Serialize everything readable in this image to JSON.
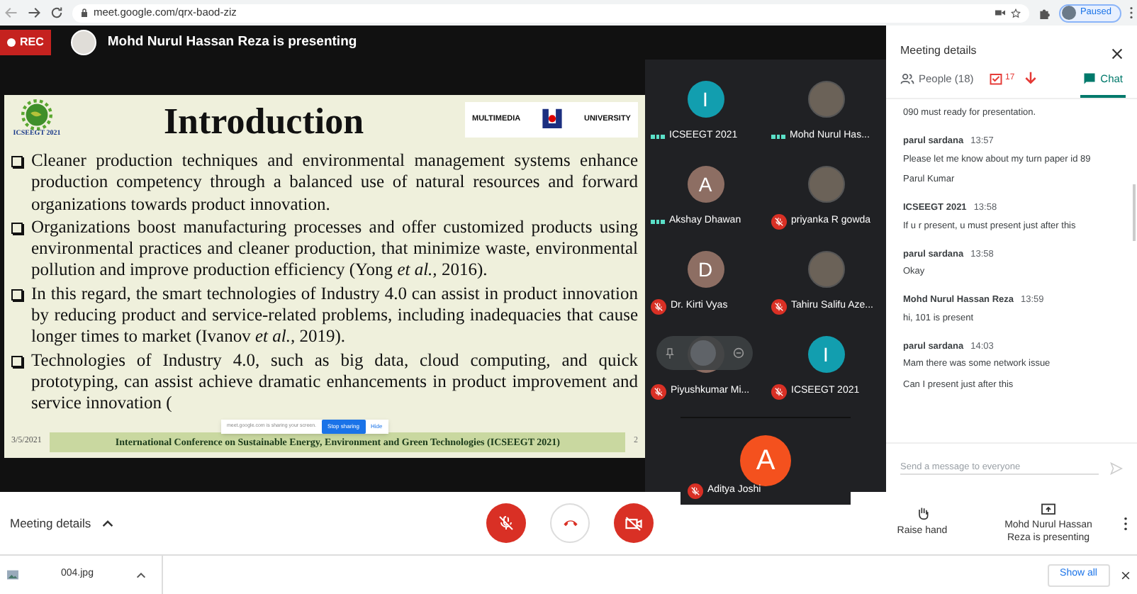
{
  "browser": {
    "url": "meet.google.com/qrx-baod-ziz",
    "profile": "Paused"
  },
  "recording": {
    "label": "REC"
  },
  "presenter_banner": "Mohd Nurul Hassan Reza is presenting",
  "slide": {
    "title": "Introduction",
    "logo_caption": "ICSEEGT 2021",
    "partner_left": "MULTIMEDIA",
    "partner_right": "UNIVERSITY",
    "bullets": [
      "Cleaner production techniques and environmental management systems enhance production competency through a balanced use of natural resources and forward organizations towards product innovation.",
      "Organizations boost manufacturing processes and offer customized products using environmental practices and cleaner production, that minimize waste, environmental pollution and improve production efficiency (Yong *et al.,* 2016).",
      "In this regard, the smart technologies of Industry 4.0 can assist in product innovation by reducing product and service-related problems, including inadequacies that cause longer times to market (Ivanov *et al.,* 2019).",
      "Technologies of Industry 4.0, such as big data, cloud computing, and quick prototyping, can assist achieve dramatic enhancements in product improvement and service innovation ("
    ],
    "date": "3/5/2021",
    "footer": "International Conference on Sustainable Energy, Environment and Green Technologies (ICSEEGT 2021)",
    "page": "2"
  },
  "share_notice": {
    "text": "meet.google.com is sharing your screen.",
    "stop": "Stop sharing",
    "hide": "Hide"
  },
  "participants": [
    {
      "name": "ICSEEGT 2021",
      "kind": "letter",
      "letter": "I",
      "color": "#129eaf",
      "muted": false,
      "hover": false
    },
    {
      "name": "Mohd Nurul Has...",
      "kind": "photo",
      "muted": false,
      "hover": false
    },
    {
      "name": "Akshay Dhawan",
      "kind": "letter",
      "letter": "A",
      "color": "#8d6e63",
      "muted": false,
      "hover": false
    },
    {
      "name": "priyanka R gowda",
      "kind": "photo",
      "muted": true,
      "hover": false
    },
    {
      "name": "Dr. Kirti Vyas",
      "kind": "letter",
      "letter": "D",
      "color": "#8d6e63",
      "muted": true,
      "hover": false
    },
    {
      "name": "Tahiru Salifu Aze...",
      "kind": "photo",
      "muted": true,
      "hover": false
    },
    {
      "name": "Piyushkumar Mi...",
      "kind": "letter",
      "color": "#8d6e63",
      "muted": true,
      "hover": true
    },
    {
      "name": "ICSEEGT 2021",
      "kind": "letter",
      "letter": "I",
      "color": "#129eaf",
      "muted": true,
      "hover": false
    }
  ],
  "featured": {
    "name": "Aditya Joshi",
    "letter": "A",
    "color": "#f4511e",
    "muted": true
  },
  "panel": {
    "title": "Meeting details",
    "tabs": [
      {
        "label": "People (18)",
        "kind": "people",
        "selected": false
      },
      {
        "label": "Chat",
        "kind": "chat",
        "selected": true
      }
    ],
    "annotation": "17",
    "messages": [
      {
        "lines": [
          "090 must ready for presentation."
        ]
      },
      {
        "sender": "parul sardana",
        "time": "13:57",
        "lines": [
          "Please let me know about my turn paper id  89",
          "Parul Kumar"
        ]
      },
      {
        "sender": "ICSEEGT 2021",
        "time": "13:58",
        "lines": [
          "If u r present, u must present just after this"
        ]
      },
      {
        "sender": "parul sardana",
        "time": "13:58",
        "lines": [
          "Okay"
        ]
      },
      {
        "sender": "Mohd Nurul Hassan Reza",
        "time": "13:59",
        "lines": [
          "hi, 101 is present"
        ]
      },
      {
        "sender": "parul sardana",
        "time": "14:03",
        "lines": [
          "Mam there was some network issue",
          "Can I present just after this"
        ]
      }
    ],
    "input": {
      "placeholder": "Send a message to everyone"
    }
  },
  "toolbar": {
    "details": "Meeting details",
    "mic_on": false,
    "camera_on": false,
    "raise_hand": "Raise hand",
    "presenting": "Mohd Nurul Hassan Reza is presenting"
  },
  "downloads": {
    "file": "004.jpg",
    "show_all": "Show all"
  }
}
